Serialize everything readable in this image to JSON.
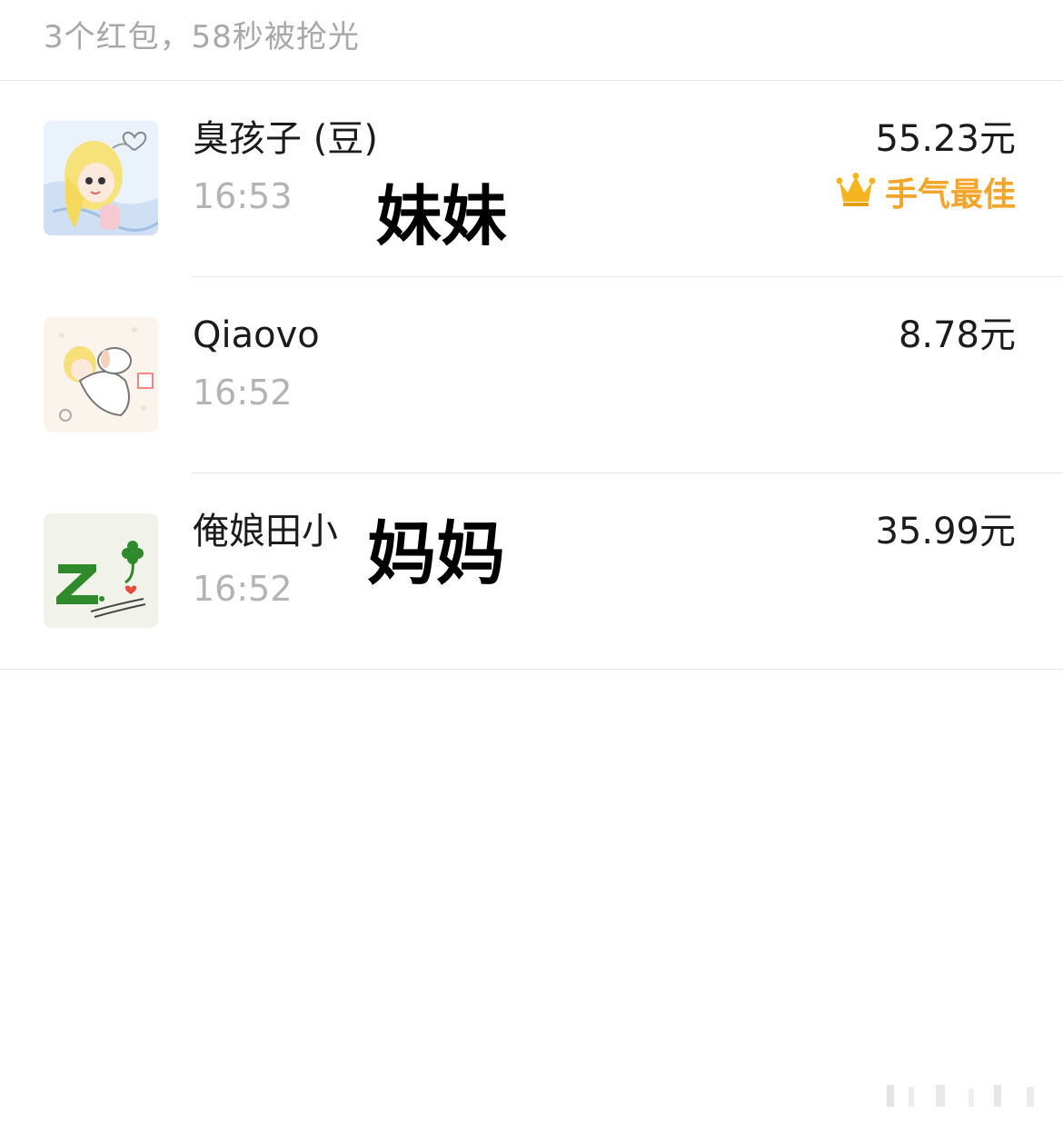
{
  "header": {
    "summary": "3个红包，58秒被抢光"
  },
  "records": [
    {
      "name": "臭孩子 (豆",
      "name_suffix": ")",
      "overlay_label": "妹妹",
      "time": "16:53",
      "amount": "55.23元",
      "best_luck_label": "手气最佳",
      "avatar": "anime-girl-avatar"
    },
    {
      "name": "Qiaovo",
      "time": "16:52",
      "amount": "8.78元",
      "avatar": "sleeping-child-avatar"
    },
    {
      "name": "俺娘田小",
      "overlay_label": "妈妈",
      "time": "16:52",
      "amount": "35.99元",
      "avatar": "z-clover-avatar"
    }
  ],
  "colors": {
    "summary_text": "#a8a8a8",
    "time_text": "#b3b3b3",
    "best_luck": "#f3a52b",
    "divider": "#e6e6e6"
  }
}
